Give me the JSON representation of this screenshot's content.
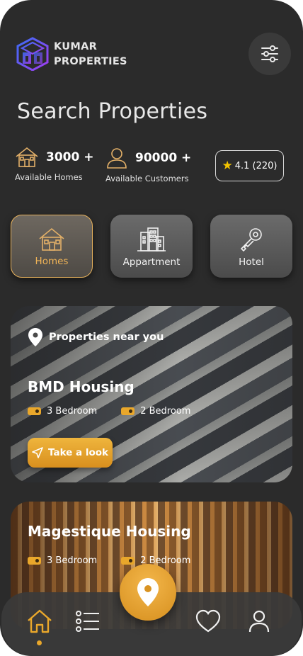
{
  "brand": {
    "line1": "KUMAR",
    "line2": "PROPERTIES"
  },
  "page_title": "Search Properties",
  "stats": {
    "homes": {
      "count": "3000 +",
      "label": "Available Homes"
    },
    "customers": {
      "count": "90000 +",
      "label": "Available Customers"
    },
    "rating": "4.1 (220)"
  },
  "categories": [
    {
      "label": "Homes",
      "icon": "house-icon",
      "active": true
    },
    {
      "label": "Appartment",
      "icon": "building-icon",
      "active": false
    },
    {
      "label": "Hotel",
      "icon": "key-icon",
      "active": false
    }
  ],
  "cards": [
    {
      "banner": "Properties near you",
      "title": "BMD Housing",
      "bed1": "3 Bedroom",
      "bed2": "2 Bedroom",
      "cta": "Take a look"
    },
    {
      "title": "Magestique Housing",
      "bed1": "3 Bedroom",
      "bed2": "2 Bedroom"
    }
  ],
  "nav": [
    "home-icon",
    "list-icon",
    "map-pin-icon",
    "heart-icon",
    "user-icon"
  ],
  "colors": {
    "accent": "#e9a72b",
    "background": "#2b2b2b",
    "active_border": "#e5b05c",
    "star": "#f2c300"
  }
}
